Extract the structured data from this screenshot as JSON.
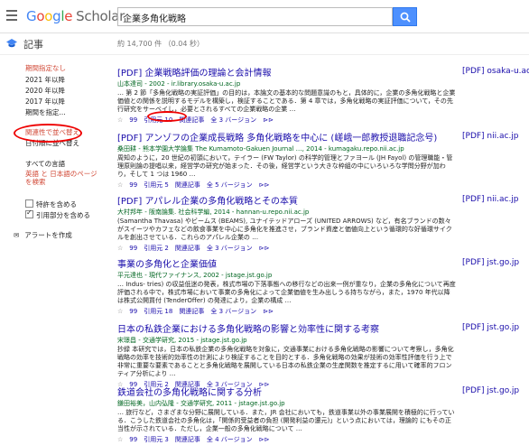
{
  "search": {
    "query": "企業多角化戦略"
  },
  "header": {
    "title": "記事",
    "count": "約 14,700 件 （0.04 秒）"
  },
  "sidebar": {
    "time": [
      "期間指定なし",
      "2021 年以降",
      "2020 年以降",
      "2017 年以降",
      "期間を指定..."
    ],
    "sort": [
      "関連性で並べ替え",
      "日付順に並べ替え"
    ],
    "lang": [
      "すべての言語",
      "英語 と 日本語のページを検索"
    ],
    "checks": [
      {
        "label": "特許を含める",
        "checked": false
      },
      {
        "label": "引用部分を含める",
        "checked": true
      }
    ],
    "alert": "アラートを作成"
  },
  "results": [
    {
      "title": "[PDF] 企業戦略評価の理論と会計情報",
      "meta": "山本達司 - 2002 - ir.library.osaka-u.ac.jp",
      "snippet": "… 第 2 節「多角化戦略の実証評価」の目的は，本論文の基本的な問題意識のもと，具体的に，企業の多角化戦略と企業価値との関係を説明するモデルを構築し，検証することである．第 4 章では，多角化戦略の実証評価について，その先行研究をサーベイし，必要とされるすべての企業戦略の企業 …",
      "actions": [
        "☆",
        "99",
        "引用元 10",
        "関連記事",
        "全 3 バージョン",
        "⊳⊳"
      ],
      "side": "[PDF] osaka-u.ac.jp"
    },
    {
      "title": "[PDF] アンゾフの企業成長戦略 多角化戦略を中心に (嵯峨一郎教授退職記念号)",
      "meta": "桑田耕 - 熊本学園大学論集 The Kumamoto-Gakuen Journal …, 2014 - kumagaku.repo.nii.ac.jp",
      "snippet": "周知のように，20 世紀の初頭において，テイラー (FW Taylor) の科学的管理とファヨール (JH Fayol) の管理職能・管理原則論の提唱以来，経営学の研究が始まった．その後，経営学という大きな枠組の中にいろいろな学問分野が加わり，そして 1 つは 1960 …",
      "actions": [
        "☆",
        "99",
        "引用元 5",
        "関連記事",
        "全 5 バージョン",
        "⊳⊳"
      ],
      "side": "[PDF] nii.ac.jp"
    },
    {
      "title": "[PDF] アパレル企業の多角化戦略とその本質",
      "meta": "大村邦年 - 阪南論集. 社会科学編, 2014 - hannan-u.repo.nii.ac.jp",
      "snippet": "(Samantha Thavasa) やビームス (BEAMS), ユナイテッドアローズ (UNITED ARROWS) など，有名ブランドの数々がスイーツやカフェなどの飲食事業を中心に多角化を推進させ，ブランド資産と価値向上という循環的な好循環サイクルを創出させている．これらのアパレル企業の …",
      "actions": [
        "☆",
        "99",
        "引用元 2",
        "関連記事",
        "全 3 バージョン",
        "⊳⊳"
      ],
      "side": "[PDF] nii.ac.jp"
    },
    {
      "title": "事業の多角化と企業価値",
      "meta": "平元達也 - 現代ファイナンス, 2002 - jstage.jst.go.jp",
      "snippet": "… Indus- tries) の収益低迷の発表，株式市場の下落事態への移行などの出来一例が重なり，企業の多角化について再度評価される中で，株式市場において事業の多角化によって企業価値を生み出しうる持ちながら，また，1970 年代以降は株式公開買付 (TenderOffer) の発達により，企業の構成 …",
      "actions": [
        "☆",
        "99",
        "引用元 18",
        "関連記事",
        "全 3 バージョン",
        "⊳⊳"
      ],
      "side": "[PDF] jst.go.jp"
    },
    {
      "title": "日本の私鉄企業における多角化戦略の影響と効率性に関する考察",
      "meta": "宋璟昌 - 交通学研究, 2015 - jstage.jst.go.jp",
      "snippet": "抄録 本研究では，日本の私鉄企業の多角化戦略を対象に，交通事業における多角化戦略の影響について考察し，多角化戦略の効率を技術的効率性の計測により検証することを目的とする．多角化戦略の効果が技術の効率性評価を行う上で非常に重要な要素であることと多角化戦略を展開している日本の私鉄企業の生産関数を推定するに用いて確率的フロンティア分析により …",
      "actions": [
        "☆",
        "99",
        "引用元 2",
        "関連記事",
        "全 3 バージョン",
        "⊳⊳"
      ],
      "side": "[PDF] jst.go.jp"
    },
    {
      "title": "鉄道会社の多角化戦略に関する分析",
      "meta": "鎌田裕美，山内弘隆 - 交通学研究, 2011 - jstage.jst.go.jp",
      "snippet": "… 旅行など，さまざまな分野に展開している．また，JR 会社においても，鉄道事業以外の事業展開を積極的に行っている．こうした鉄道会社の多角化は，「関係的受益者の負担 (開発利益の還元)」という点においては，理論的 にもその正当性が示されている．ただし，企業一般の多角化戦略について …",
      "actions": [
        "☆",
        "99",
        "引用元 3",
        "関連記事",
        "全 4 バージョン",
        "⊳⊳"
      ],
      "side": "[PDF] jst.go.jp"
    }
  ]
}
